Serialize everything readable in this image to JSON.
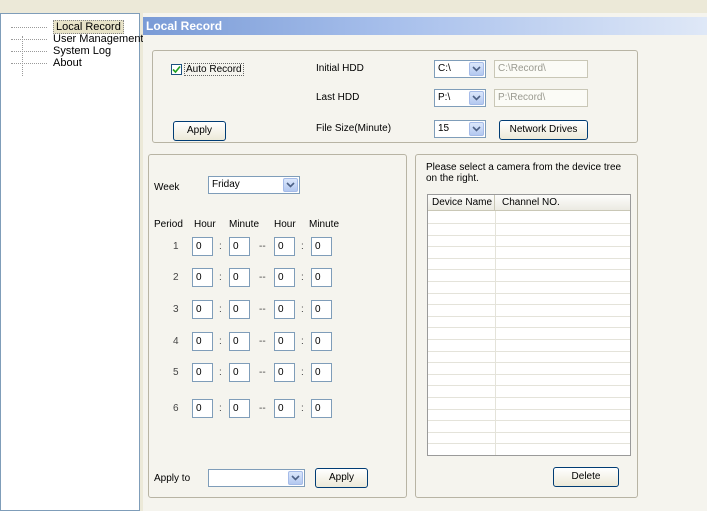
{
  "sidebar": {
    "items": [
      {
        "label": "Local Record",
        "selected": true
      },
      {
        "label": "User Management",
        "selected": false
      },
      {
        "label": "System Log",
        "selected": false
      },
      {
        "label": "About",
        "selected": false
      }
    ]
  },
  "page": {
    "title": "Local Record"
  },
  "record_settings": {
    "auto_record_label": "Auto Record",
    "auto_record_checked": true,
    "apply_label": "Apply",
    "initial_hdd_label": "Initial HDD",
    "initial_hdd_value": "C:\\",
    "initial_hdd_path": "C:\\Record\\",
    "last_hdd_label": "Last HDD",
    "last_hdd_value": "P:\\",
    "last_hdd_path": "P:\\Record\\",
    "file_size_label": "File Size(Minute)",
    "file_size_value": "15",
    "network_drives_label": "Network Drives"
  },
  "schedule": {
    "week_label": "Week",
    "week_value": "Friday",
    "headers": {
      "period": "Period",
      "hour1": "Hour",
      "minute1": "Minute",
      "hour2": "Hour",
      "minute2": "Minute"
    },
    "periods": [
      {
        "num": "1",
        "start_hour": "0",
        "start_minute": "0",
        "end_hour": "0",
        "end_minute": "0"
      },
      {
        "num": "2",
        "start_hour": "0",
        "start_minute": "0",
        "end_hour": "0",
        "end_minute": "0"
      },
      {
        "num": "3",
        "start_hour": "0",
        "start_minute": "0",
        "end_hour": "0",
        "end_minute": "0"
      },
      {
        "num": "4",
        "start_hour": "0",
        "start_minute": "0",
        "end_hour": "0",
        "end_minute": "0"
      },
      {
        "num": "5",
        "start_hour": "0",
        "start_minute": "0",
        "end_hour": "0",
        "end_minute": "0"
      },
      {
        "num": "6",
        "start_hour": "0",
        "start_minute": "0",
        "end_hour": "0",
        "end_minute": "0"
      }
    ],
    "colon": ":",
    "range_sep": "--",
    "apply_to_label": "Apply to",
    "apply_to_value": "",
    "apply_label": "Apply"
  },
  "camera_panel": {
    "instruction": "Please select a camera from the device tree on the right.",
    "columns": [
      "Device Name",
      "Channel NO."
    ],
    "rows": [],
    "delete_label": "Delete"
  },
  "colors": {
    "title_gradient_start": "#7a9bd6",
    "window_bg": "#ece9d8",
    "panel_bg": "#f5f4ee",
    "input_border": "#7f9db9",
    "button_border": "#003c74",
    "check_green": "#21a121"
  },
  "icons": {
    "dropdown": "chevron-down-icon",
    "checkbox": "checkmark-icon"
  }
}
